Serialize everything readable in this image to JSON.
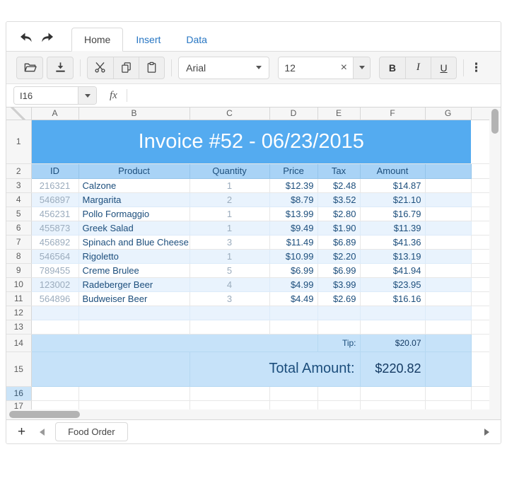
{
  "tabstrip": {
    "tabs": [
      {
        "label": "Home",
        "active": true
      },
      {
        "label": "Insert",
        "active": false
      },
      {
        "label": "Data",
        "active": false
      }
    ]
  },
  "toolbar": {
    "font_family_value": "Arial",
    "font_size_value": "12",
    "bold_label": "B",
    "italic_label": "I",
    "underline_label": "U",
    "clear_glyph": "×",
    "overflow_glyph": "⋮",
    "icon_names": [
      "undo-icon",
      "redo-icon",
      "open-file-icon",
      "export-icon",
      "cut-icon",
      "copy-icon",
      "paste-icon",
      "clear-icon",
      "dropdown-caret-icon",
      "overflow-menu-icon"
    ]
  },
  "formula_bar": {
    "cell_reference": "I16",
    "fx_label": "fx",
    "formula_value": ""
  },
  "sheet": {
    "columns": [
      "A",
      "B",
      "C",
      "D",
      "E",
      "F",
      "G"
    ],
    "first_row_number": 1,
    "last_row_number": 17,
    "selected_row_header": 16,
    "banner": {
      "row": 1,
      "text": "Invoice #52 - 06/23/2015"
    },
    "table_headers": [
      "ID",
      "Product",
      "Quantity",
      "Price",
      "Tax",
      "Amount"
    ],
    "items": [
      {
        "row": 3,
        "id": "216321",
        "product": "Calzone",
        "quantity": "1",
        "price": "$12.39",
        "tax": "$2.48",
        "amount": "$14.87"
      },
      {
        "row": 4,
        "id": "546897",
        "product": "Margarita",
        "quantity": "2",
        "price": "$8.79",
        "tax": "$3.52",
        "amount": "$21.10"
      },
      {
        "row": 5,
        "id": "456231",
        "product": "Pollo Formaggio",
        "quantity": "1",
        "price": "$13.99",
        "tax": "$2.80",
        "amount": "$16.79"
      },
      {
        "row": 6,
        "id": "455873",
        "product": "Greek Salad",
        "quantity": "1",
        "price": "$9.49",
        "tax": "$1.90",
        "amount": "$11.39"
      },
      {
        "row": 7,
        "id": "456892",
        "product": "Spinach and Blue Cheese",
        "quantity": "3",
        "price": "$11.49",
        "tax": "$6.89",
        "amount": "$41.36"
      },
      {
        "row": 8,
        "id": "546564",
        "product": "Rigoletto",
        "quantity": "1",
        "price": "$10.99",
        "tax": "$2.20",
        "amount": "$13.19"
      },
      {
        "row": 9,
        "id": "789455",
        "product": "Creme Brulee",
        "quantity": "5",
        "price": "$6.99",
        "tax": "$6.99",
        "amount": "$41.94"
      },
      {
        "row": 10,
        "id": "123002",
        "product": "Radeberger Beer",
        "quantity": "4",
        "price": "$4.99",
        "tax": "$3.99",
        "amount": "$23.95"
      },
      {
        "row": 11,
        "id": "564896",
        "product": "Budweiser Beer",
        "quantity": "3",
        "price": "$4.49",
        "tax": "$2.69",
        "amount": "$16.16"
      }
    ],
    "tip": {
      "row": 14,
      "label": "Tip:",
      "value": "$20.07"
    },
    "total": {
      "row": 15,
      "label": "Total Amount:",
      "value": "$220.82"
    }
  },
  "sheet_bar": {
    "add_sheet_label": "+",
    "active_sheet": "Food Order"
  },
  "colors": {
    "banner-fill": "#54abf0",
    "banner-text": "#ffffff",
    "header-fill": "#a9d3f6",
    "band-fill": "#e9f3fd",
    "totals-fill": "#c6e2f9",
    "navy-text": "#1c4e7c",
    "bold-navy": "#143a63",
    "muted-cell-text": "#9bacbd",
    "accent-link": "#2776c3",
    "selected-header-fill": "#cbe4f8"
  }
}
